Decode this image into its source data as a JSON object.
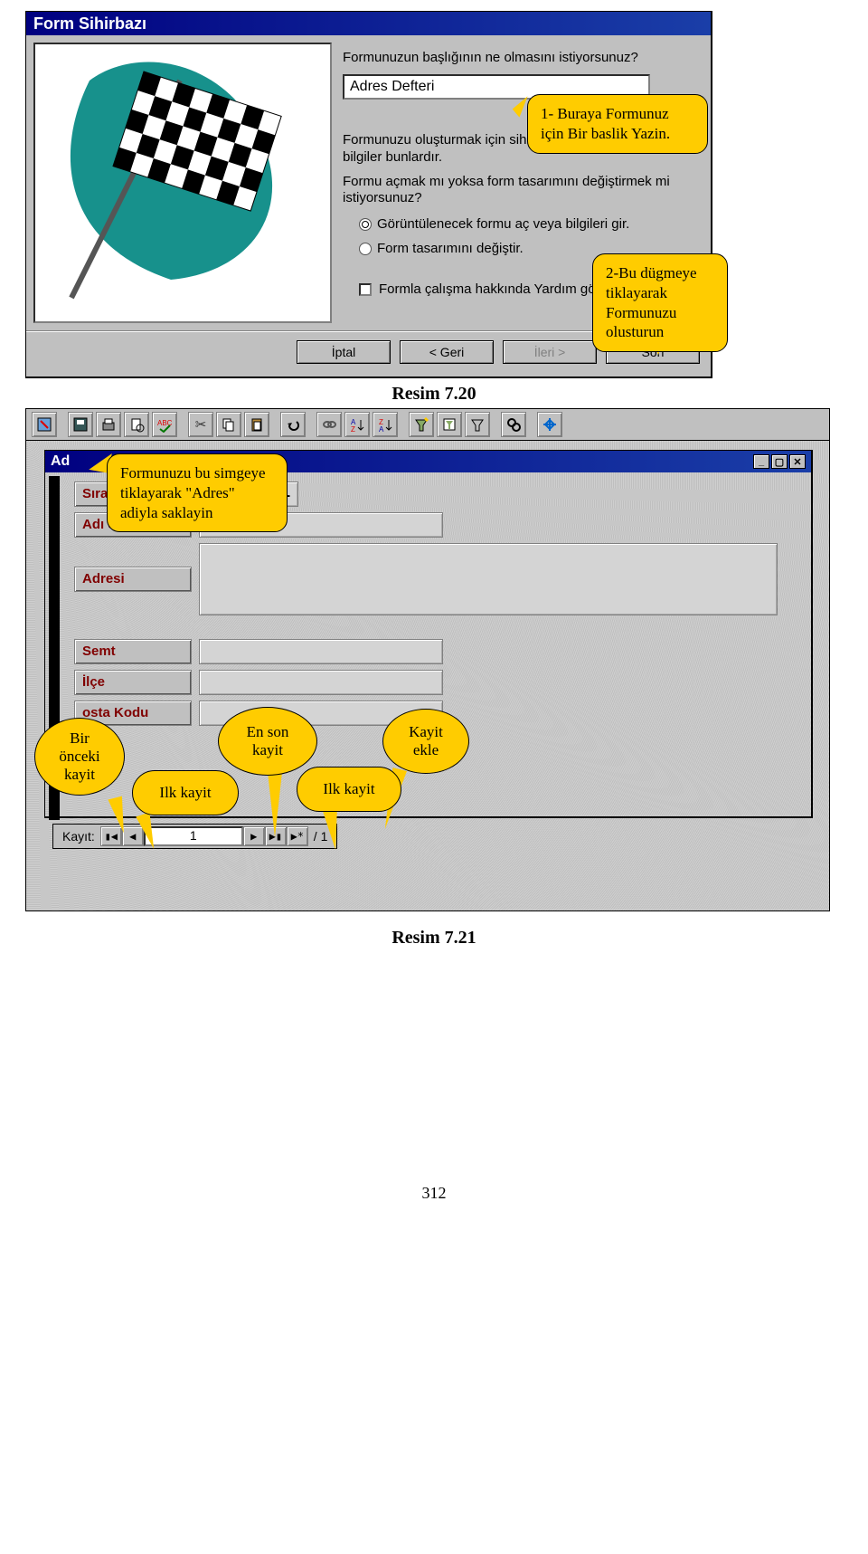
{
  "wizard": {
    "title": "Form Sihirbazı",
    "question1": "Formunuzun başlığının ne olmasını istiyorsunuz?",
    "title_value": "Adres Defteri",
    "para1": "Formunuzu oluşturmak için sihirbazın gerek duyduğu tüm bilgiler bunlardır.",
    "para2": "Formu açmak mı yoksa form tasarımını değiştirmek mi istiyorsunuz?",
    "radio1": "Görüntülenecek formu aç veya bilgileri gir.",
    "radio2": "Form tasarımını değiştir.",
    "chk": "Formla çalışma hakkında Yardım gö",
    "buttons": {
      "cancel": "İptal",
      "back": "< Geri",
      "next": "İleri >",
      "finish": "Son"
    }
  },
  "callouts": {
    "c1": "1- Buraya Formunuz için Bir baslik Yazin.",
    "c2": "2-Bu dügmeye tiklayarak Formunuzu olusturun",
    "c3": "Formunuzu bu simgeye tiklayarak \"Adres\" adiyla saklayin"
  },
  "captions": {
    "r1": "Resim 7.20",
    "r2": "Resim 7.21"
  },
  "formwin": {
    "title_prefix": "Ad",
    "fields": {
      "sira": "Sıra",
      "adi": "Adı S",
      "adresi": "Adresi",
      "semt": "Semt",
      "ilce": "İlçe",
      "posta": "osta Kodu"
    },
    "sira_value": "1",
    "nav_label": "Kayıt:",
    "nav_value": "1",
    "nav_total": "/  1"
  },
  "bubbles": {
    "b1": "Bir önceki kayit",
    "b2": "Ilk kayit",
    "b3": "En son kayit",
    "b4": "Ilk kayit",
    "b5": "Kayit ekle"
  },
  "page_number": "312"
}
